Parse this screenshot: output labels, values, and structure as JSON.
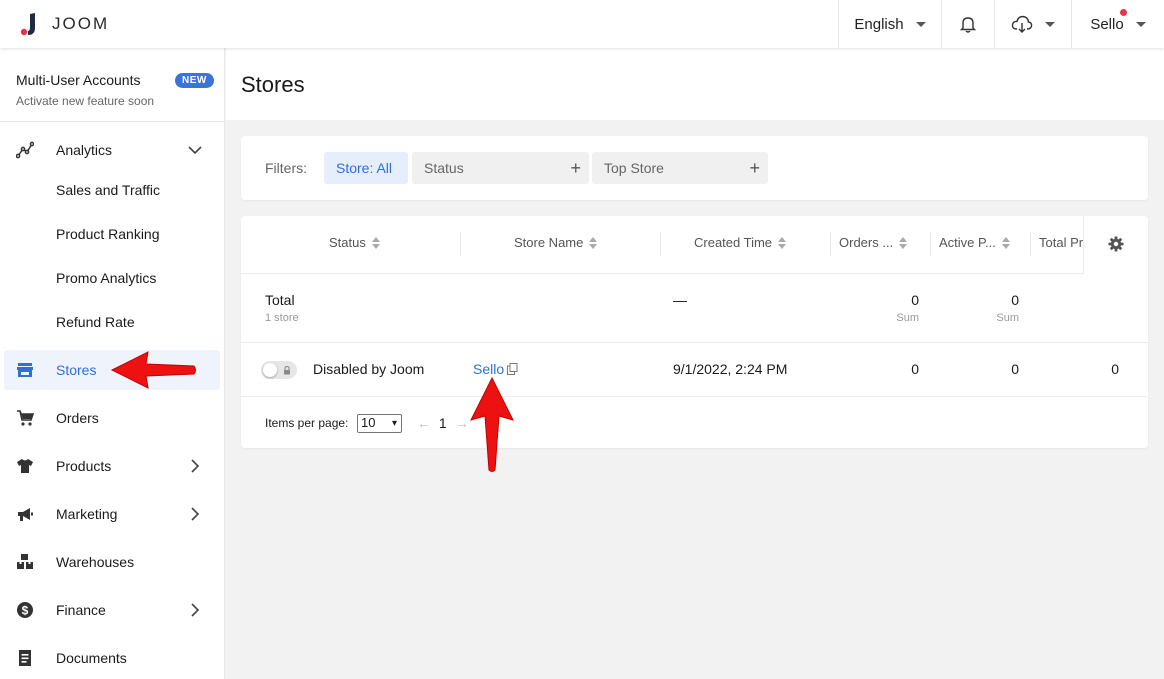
{
  "topbar": {
    "logo_text": "JOOM",
    "language": "English",
    "user": "Sello",
    "icons": [
      "bell-icon",
      "cloud-download-icon"
    ]
  },
  "sidebar": {
    "promo_title": "Multi-User Accounts",
    "promo_badge": "NEW",
    "promo_subtitle": "Activate new feature soon",
    "analytics": {
      "label": "Analytics",
      "children": [
        "Sales and Traffic",
        "Product Ranking",
        "Promo Analytics",
        "Refund Rate"
      ]
    },
    "items": [
      {
        "label": "Stores",
        "icon": "store-icon",
        "active": true
      },
      {
        "label": "Orders",
        "icon": "cart-icon"
      },
      {
        "label": "Products",
        "icon": "tshirt-icon"
      },
      {
        "label": "Marketing",
        "icon": "megaphone-icon"
      },
      {
        "label": "Warehouses",
        "icon": "boxes-icon"
      },
      {
        "label": "Finance",
        "icon": "dollar-icon"
      },
      {
        "label": "Documents",
        "icon": "document-icon"
      }
    ]
  },
  "page": {
    "title": "Stores"
  },
  "filters": {
    "label": "Filters:",
    "store_chip": "Store: All",
    "status_chip": "Status",
    "top_store_chip": "Top Store"
  },
  "table": {
    "columns": [
      "Status",
      "Store Name",
      "Created Time",
      "Orders ...",
      "Active P...",
      "Total Pr"
    ],
    "total": {
      "label": "Total",
      "count": "1 store",
      "created": "—",
      "orders": "0",
      "orders_sub": "Sum",
      "active": "0",
      "active_sub": "Sum"
    },
    "rows": [
      {
        "status": "Disabled by Joom",
        "store_name": "Sello",
        "created": "9/1/2022, 2:24 PM",
        "orders": "0",
        "active": "0",
        "total": "0"
      }
    ],
    "pager": {
      "label": "Items per page:",
      "per_page": "10",
      "page": "1"
    }
  },
  "colors": {
    "accent": "#2f6fdb",
    "arrow": "#ee1111",
    "badge": "#3a73d9"
  }
}
